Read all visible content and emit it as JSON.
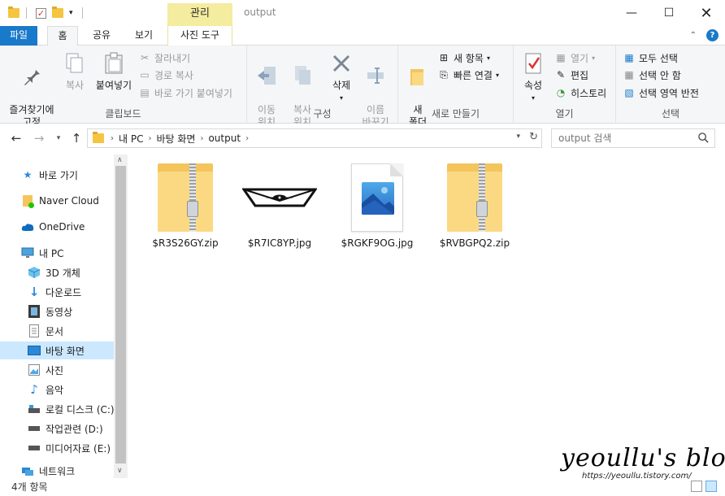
{
  "window": {
    "title": "output",
    "context_tab_header": "관리",
    "controls": {
      "minimize": "—",
      "maximize": "☐",
      "close": "✕"
    }
  },
  "tabs": [
    {
      "label": "파일"
    },
    {
      "label": "홈"
    },
    {
      "label": "공유"
    },
    {
      "label": "보기"
    },
    {
      "label": "사진 도구"
    }
  ],
  "ribbon": {
    "clipboard": {
      "label": "클립보드",
      "pin": "즐겨찾기에\n고정",
      "copy": "복사",
      "paste": "붙여넣기",
      "cut": "잘라내기",
      "copy_path": "경로 복사",
      "paste_shortcut": "바로 가기 붙여넣기"
    },
    "organize": {
      "label": "구성",
      "move_to": "이동\n위치",
      "copy_to": "복사\n위치",
      "delete": "삭제",
      "rename": "이름\n바꾸기"
    },
    "new": {
      "label": "새로 만들기",
      "new_folder": "새\n폴더",
      "new_item": "새 항목",
      "easy_access": "빠른 연결"
    },
    "open": {
      "label": "열기",
      "properties": "속성",
      "open": "열기",
      "edit": "편집",
      "history": "히스토리"
    },
    "select": {
      "label": "선택",
      "select_all": "모두 선택",
      "select_none": "선택 안 함",
      "invert": "선택 영역 반전"
    }
  },
  "address": {
    "crumbs": [
      "내 PC",
      "바탕 화면",
      "output"
    ],
    "search_placeholder": "output 검색"
  },
  "nav": [
    {
      "label": "바로 가기",
      "icon": "star-icon"
    },
    {
      "label": "Naver Cloud",
      "icon": "naver-cloud-icon"
    },
    {
      "label": "OneDrive",
      "icon": "onedrive-icon"
    },
    {
      "label": "내 PC",
      "icon": "computer-icon"
    },
    {
      "label": "3D 개체",
      "icon": "cube-icon"
    },
    {
      "label": "다운로드",
      "icon": "download-icon"
    },
    {
      "label": "동영상",
      "icon": "film-icon"
    },
    {
      "label": "문서",
      "icon": "document-icon"
    },
    {
      "label": "바탕 화면",
      "icon": "desktop-icon",
      "selected": true
    },
    {
      "label": "사진",
      "icon": "picture-icon"
    },
    {
      "label": "음악",
      "icon": "music-icon"
    },
    {
      "label": "로컬 디스크 (C:)",
      "icon": "drive-icon"
    },
    {
      "label": "작업관련 (D:)",
      "icon": "drive-icon"
    },
    {
      "label": "미디어자료 (E:)",
      "icon": "drive-icon"
    },
    {
      "label": "네트워크",
      "icon": "network-icon"
    }
  ],
  "files": [
    {
      "name": "$R3S26GY.zip",
      "type": "zip"
    },
    {
      "name": "$R7IC8YP.jpg",
      "type": "jpg-thumb"
    },
    {
      "name": "$RGKF9OG.jpg",
      "type": "jpg"
    },
    {
      "name": "$RVBGPQ2.zip",
      "type": "zip"
    }
  ],
  "status": {
    "count": "4개 항목"
  },
  "watermark": {
    "title": "yeoullu's blog",
    "url": "https://yeoullu.tistory.com/"
  },
  "colors": {
    "accent": "#1979ca",
    "context_tab": "#f4ec9e",
    "selected": "#cce8ff",
    "folder": "#f4c55c"
  }
}
